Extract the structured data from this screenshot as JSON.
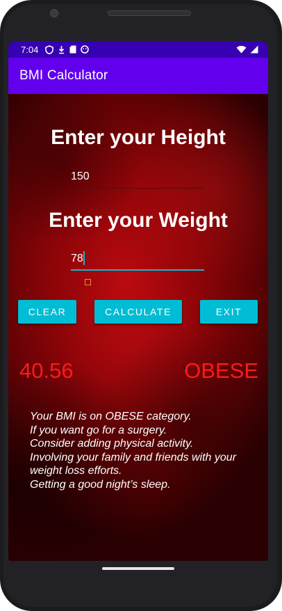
{
  "status_bar": {
    "time": "7:04",
    "icons": [
      "shield-icon",
      "download-icon",
      "sd-card-icon",
      "face-icon"
    ],
    "right_icons": [
      "wifi-icon",
      "signal-icon"
    ]
  },
  "app_bar": {
    "title": "BMI Calculator"
  },
  "height_section": {
    "heading": "Enter your Height",
    "value": "150"
  },
  "weight_section": {
    "heading": "Enter your Weight",
    "value": "78"
  },
  "buttons": {
    "clear": "CLEAR",
    "calculate": "CALCULATE",
    "exit": "EXIT"
  },
  "result": {
    "bmi_value": "40.56",
    "category": "OBESE"
  },
  "advice": [
    "Your BMI is on OBESE category.",
    "If you want go for a surgery.",
    "Consider adding physical activity.",
    "Involving your family and friends with your",
    "weight loss efforts.",
    "Getting a good night’s sleep."
  ],
  "colors": {
    "status_bar": "#3700b3",
    "app_bar": "#6200ee",
    "button": "#00bcd4",
    "result_text": "#ff1a1a",
    "accent": "#18b3c8"
  }
}
